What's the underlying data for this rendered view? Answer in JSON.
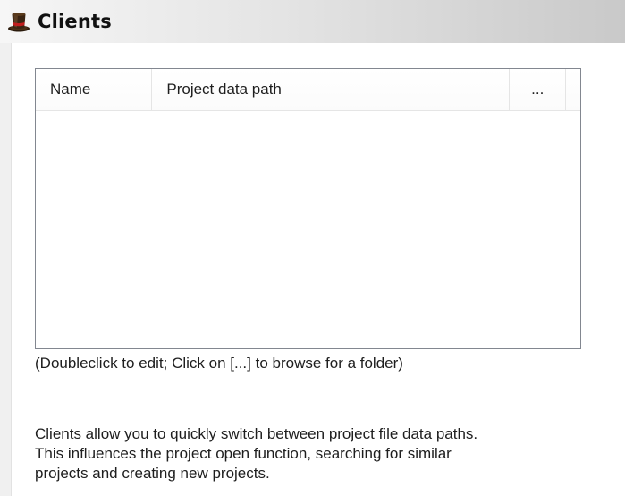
{
  "header": {
    "title": "Clients",
    "icon": "top-hat-icon"
  },
  "clients_list": {
    "columns": {
      "name": "Name",
      "path": "Project data path",
      "browse": "..."
    },
    "rows": []
  },
  "hint_text": "(Doubleclick to edit; Click on [...] to browse for a folder)",
  "description": {
    "line1": "Clients allow you to quickly switch between project file data paths.",
    "line2": "This influences the project open function, searching for similar",
    "line3": "projects and creating new projects."
  }
}
